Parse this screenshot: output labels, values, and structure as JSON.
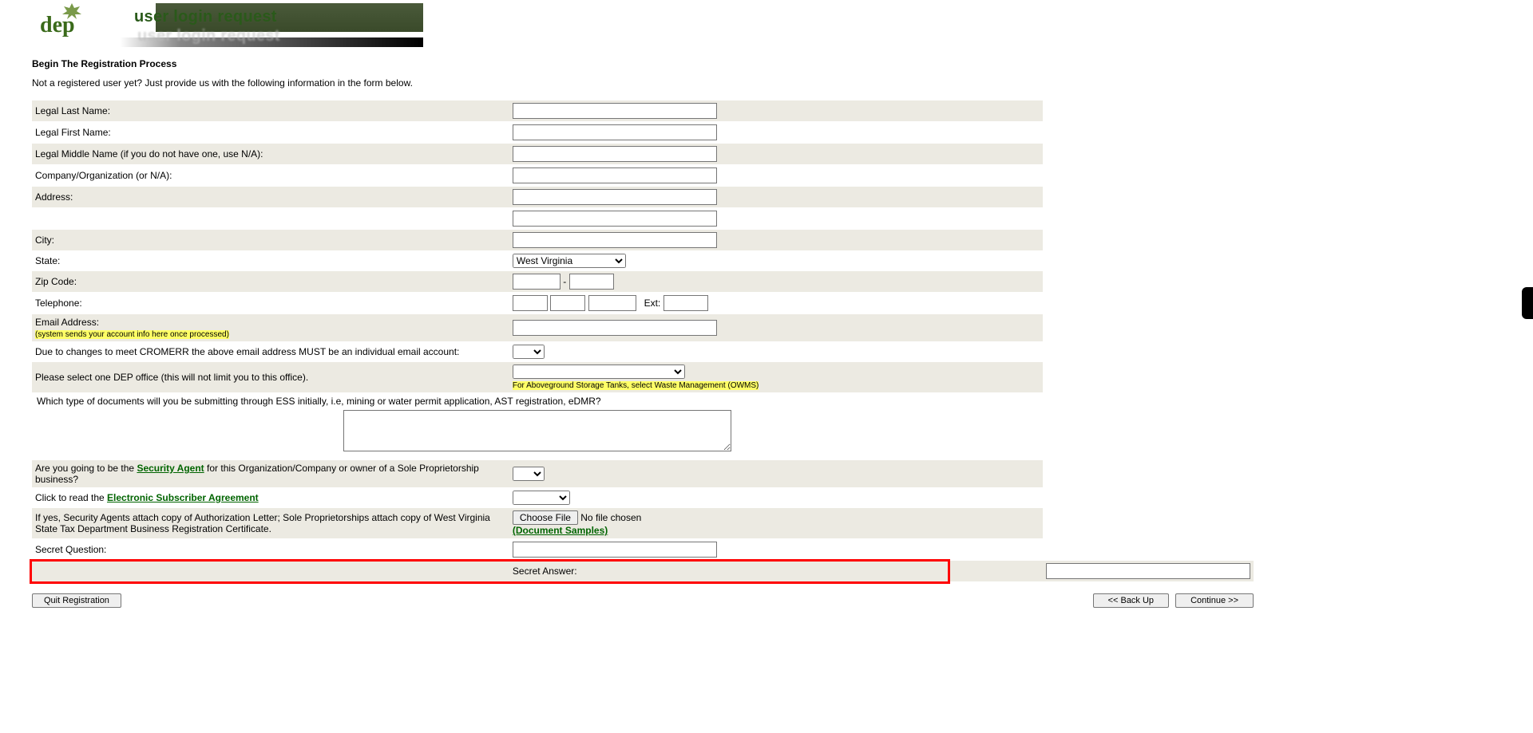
{
  "banner": {
    "logo_text": "dep",
    "title": "user login request"
  },
  "heading": "Begin The Registration Process",
  "intro": "Not a registered user yet? Just provide us with the following information in the form below.",
  "labels": {
    "last_name": "Legal Last Name:",
    "first_name": "Legal First Name:",
    "middle_name": "Legal Middle Name (if you do not have one, use N/A):",
    "company": "Company/Organization (or N/A):",
    "address": "Address:",
    "city": "City:",
    "state": "State:",
    "zip": "Zip Code:",
    "telephone": "Telephone:",
    "ext": "Ext:",
    "email": "Email Address:",
    "email_note": "(system sends your account info here once processed)",
    "cromerr": "Due to changes to meet CROMERR the above email address MUST be an individual email account:",
    "dep_office": "Please select one DEP office (this will not limit you to this office).",
    "dep_note": "For Aboveground Storage Tanks, select Waste Management (OWMS)",
    "docs_question": "Which type of documents will you be submitting through ESS initially, i.e, mining or water permit application, AST registration, eDMR?",
    "sec_agent_prefix": "Are you going to be the ",
    "sec_agent_link": "Security Agent",
    "sec_agent_suffix": " for this Organization/Company or owner of a Sole Proprietorship business?",
    "esa_prefix": "Click to read the ",
    "esa_link": "Electronic Subscriber Agreement",
    "auth_letter": "If yes, Security Agents attach copy of Authorization Letter; Sole Proprietorships attach copy of West Virginia State Tax Department Business Registration Certificate.",
    "choose_file": "Choose File",
    "no_file": "No file chosen",
    "doc_samples": "(Document Samples)",
    "secret_q": "Secret Question:",
    "secret_a": "Secret Answer:",
    "zip_dash": " - "
  },
  "state_selected": "West Virginia",
  "buttons": {
    "quit": "Quit Registration",
    "back": "<< Back Up",
    "continue": "Continue >>"
  }
}
